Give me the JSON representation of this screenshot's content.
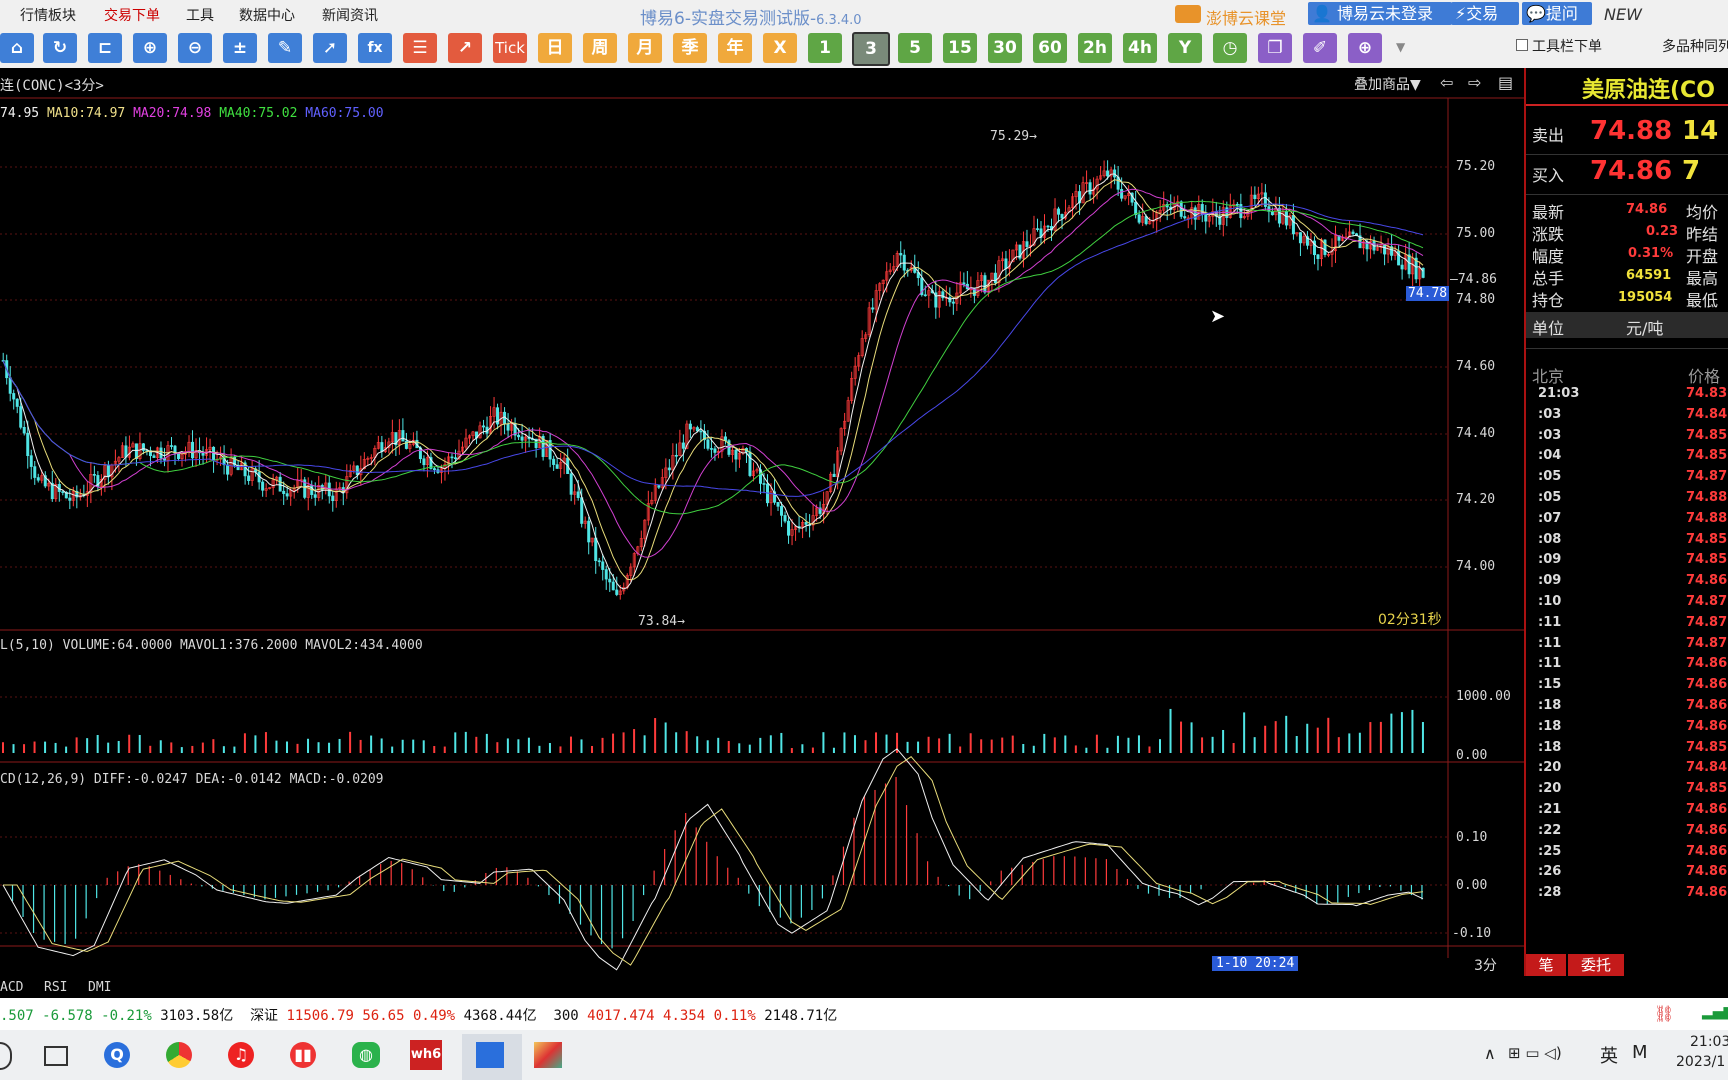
{
  "menu": {
    "items": [
      "行情板块",
      "交易下单",
      "工具",
      "数据中心",
      "新闻资讯"
    ],
    "title": "博易6-实盘交易测试版-",
    "version": "6.3.4.0",
    "classroom": "澎博云课堂",
    "login": "博易云未登录",
    "trade": "交易",
    "ask": "提问",
    "new": "NEW"
  },
  "toolbar": {
    "text_buttons": [
      "Tick",
      "日",
      "周",
      "月",
      "季",
      "年",
      "X",
      "1",
      "3",
      "5",
      "15",
      "30",
      "60",
      "2h",
      "4h",
      "Y"
    ],
    "selected": "3",
    "toolbar_order": "工具栏下单",
    "multi_contract": "多品种同列"
  },
  "chart": {
    "title": "连(CONC)<3分>",
    "overlay": "叠加商品▼",
    "ma_line": {
      "ma5": "74.95",
      "ma10": "MA10:74.97",
      "ma20": "MA20:74.98",
      "ma40": "MA40:75.02",
      "ma60": "MA60:75.00"
    },
    "high_mark": "75.29",
    "low_mark": "73.84",
    "last_price_right": "74.86",
    "cursor_price": "74.78",
    "countdown": "02分31秒",
    "price_ticks": [
      "75.20",
      "75.00",
      "74.80",
      "74.60",
      "74.40",
      "74.20",
      "74.00"
    ],
    "vol_label": "L(5,10) VOLUME:64.0000 MAVOL1:376.2000 MAVOL2:434.4000",
    "vol_ticks": [
      "1000.00",
      "0.00"
    ],
    "macd_label": "CD(12,26,9) DIFF:-0.0247 DEA:-0.0142 MACD:-0.0209",
    "macd_ticks": [
      "0.10",
      "0.00",
      "-0.10"
    ],
    "time_label": "1-10 20:24",
    "period": "3分",
    "tabs": [
      "ACD",
      "RSI",
      "DMI"
    ]
  },
  "panel": {
    "name": "美原油连(CO",
    "sell_label": "卖出",
    "sell_price": "74.88",
    "sell_qty": "14",
    "buy_label": "买入",
    "buy_price": "74.86",
    "buy_qty": "7",
    "stats": [
      {
        "k": "最新",
        "v": "74.86",
        "k2": "均价"
      },
      {
        "k": "涨跌",
        "v": "0.23",
        "k2": "昨结"
      },
      {
        "k": "幅度",
        "v": "0.31%",
        "k2": "开盘"
      },
      {
        "k": "总手",
        "v": "64591",
        "k2": "最高"
      },
      {
        "k": "持仓",
        "v": "195054",
        "k2": "最低"
      }
    ],
    "unit_label": "单位",
    "unit_value": "元/吨",
    "tick_header_left": "北京",
    "tick_header_right": "价格",
    "ticks": [
      {
        "t": "21:03",
        "p": "74.83"
      },
      {
        "t": ":03",
        "p": "74.84"
      },
      {
        "t": ":03",
        "p": "74.85"
      },
      {
        "t": ":04",
        "p": "74.85"
      },
      {
        "t": ":05",
        "p": "74.87"
      },
      {
        "t": ":05",
        "p": "74.88"
      },
      {
        "t": ":07",
        "p": "74.88"
      },
      {
        "t": ":08",
        "p": "74.85"
      },
      {
        "t": ":09",
        "p": "74.85"
      },
      {
        "t": ":09",
        "p": "74.86"
      },
      {
        "t": ":10",
        "p": "74.87"
      },
      {
        "t": ":11",
        "p": "74.87"
      },
      {
        "t": ":11",
        "p": "74.87"
      },
      {
        "t": ":11",
        "p": "74.86"
      },
      {
        "t": ":15",
        "p": "74.86"
      },
      {
        "t": ":18",
        "p": "74.86"
      },
      {
        "t": ":18",
        "p": "74.86"
      },
      {
        "t": ":18",
        "p": "74.85"
      },
      {
        "t": ":20",
        "p": "74.84"
      },
      {
        "t": ":20",
        "p": "74.85"
      },
      {
        "t": ":21",
        "p": "74.86"
      },
      {
        "t": ":22",
        "p": "74.86"
      },
      {
        "t": ":25",
        "p": "74.86"
      },
      {
        "t": ":26",
        "p": "74.86"
      },
      {
        "t": ":28",
        "p": "74.86"
      }
    ],
    "bottom_tabs": [
      "笔",
      "委托"
    ]
  },
  "status": {
    "idx1_a": ".507",
    "idx1_b": "-6.578",
    "idx1_c": "-0.21%",
    "idx1_d": "3103.58亿",
    "idx2_name": "深证",
    "idx2_a": "11506.79",
    "idx2_b": "56.65",
    "idx2_c": "0.49%",
    "idx2_d": "4368.44亿",
    "idx3_name": "300",
    "idx3_a": "4017.474",
    "idx3_b": "4.354",
    "idx3_c": "0.11%",
    "idx3_d": "2148.71亿"
  },
  "taskbar": {
    "ime": "英",
    "ime2": "M",
    "time": "21:03",
    "date": "2023/1"
  }
}
